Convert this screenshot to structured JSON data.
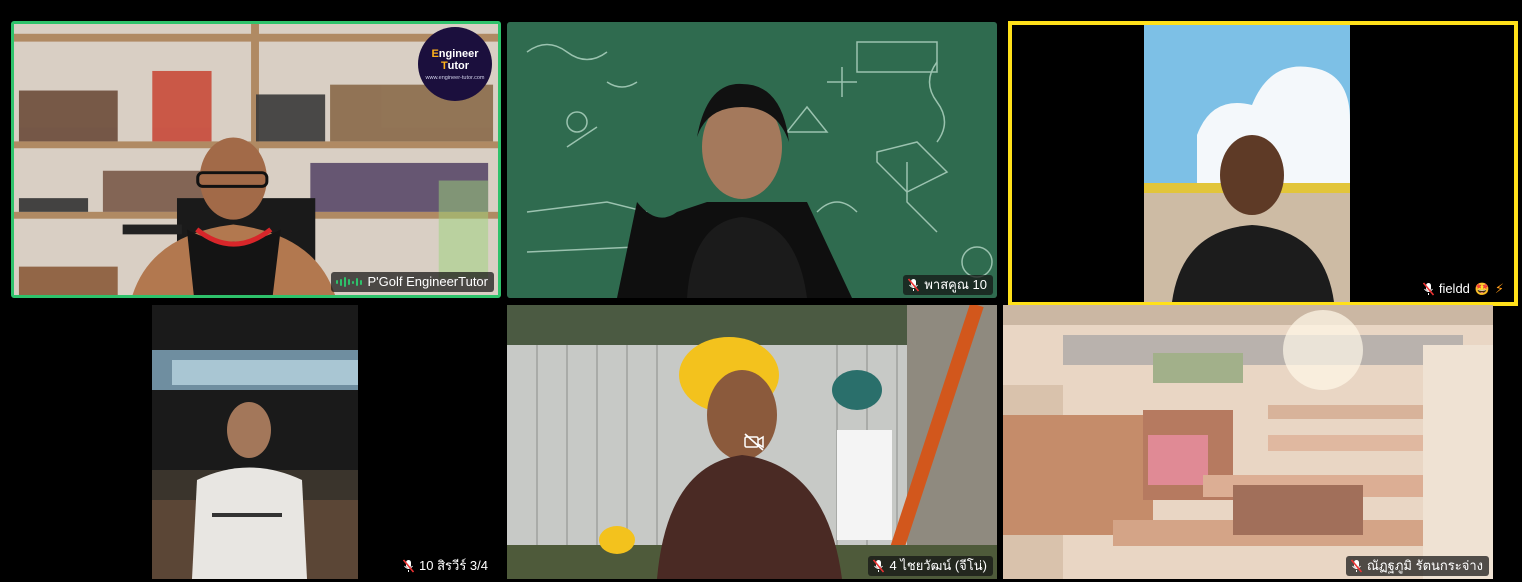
{
  "participants": [
    {
      "name": "P'Golf EngineerTutor",
      "speaking": true
    },
    {
      "name": "พาสคูณ 10",
      "muted": true
    },
    {
      "name": "fieldd",
      "emoji": "🤩",
      "flag": "⚡",
      "muted": true,
      "pinned_highlight": true
    },
    {
      "name": "10 สิรวีร์ 3/4",
      "muted": true
    },
    {
      "name": "4 ไชยวัฒน์ (จีโน่)",
      "muted": true,
      "video_off_overlay": true
    },
    {
      "name": "ณัฏฐภูมิ รัตนกระจ่าง",
      "muted": true
    }
  ],
  "logo": {
    "prefix": "E",
    "text_a": "ngineer ",
    "text_b": "T",
    "text_c": "utor",
    "url": "www.engineer-tutor.com"
  },
  "colors": {
    "speaking_border": "#2ec26b",
    "highlight_border": "#ffe01a"
  }
}
